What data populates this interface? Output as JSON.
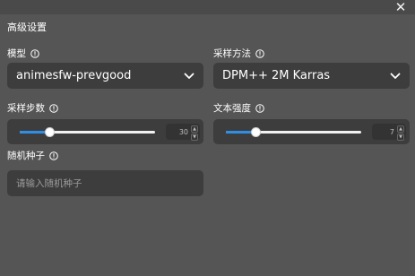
{
  "header": {
    "close_symbol": "✕"
  },
  "panel_title": "高级设置",
  "model": {
    "label": "模型",
    "value": "animesfw-prevgood"
  },
  "sampler": {
    "label": "采样方法",
    "value": "DPM++ 2M Karras"
  },
  "steps": {
    "label": "采样步数",
    "value": "30",
    "slider_fraction": 0.22
  },
  "cfg": {
    "label": "文本强度",
    "value": "7",
    "slider_fraction": 0.22
  },
  "seed": {
    "label": "随机种子",
    "placeholder": "请输入随机种子",
    "value": ""
  },
  "colors": {
    "background": "#555555",
    "control_bg": "#3d3d3d",
    "accent": "#2f8fe6"
  },
  "icons": [
    "close-icon",
    "info-icon",
    "chevron-down-icon",
    "spinner-up-icon",
    "spinner-down-icon"
  ]
}
